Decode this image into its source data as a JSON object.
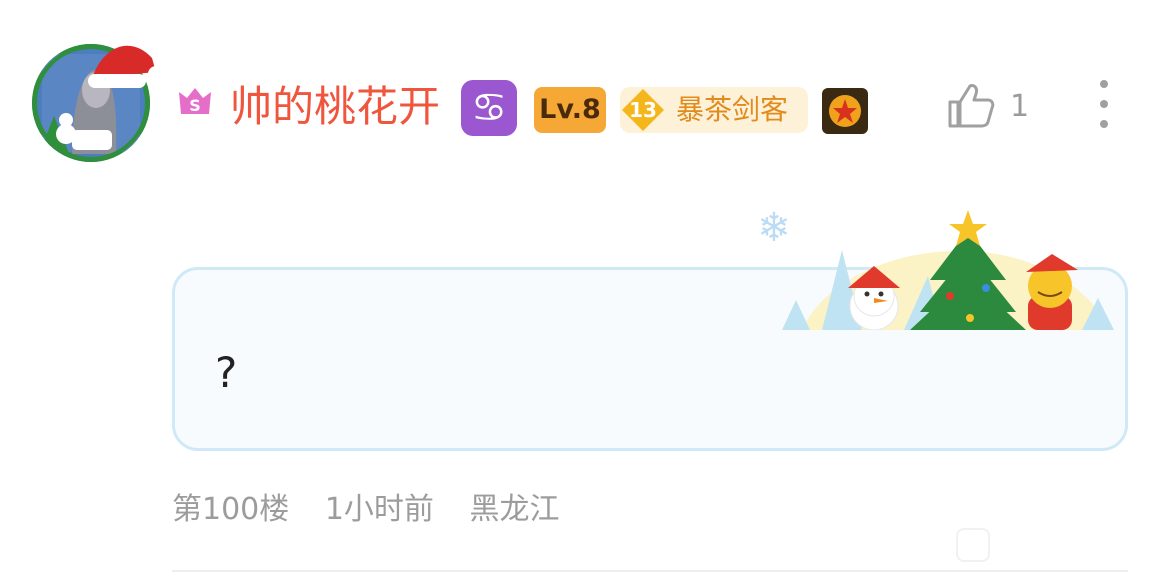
{
  "post": {
    "username": "帅的桃花开",
    "zodiac_symbol": "♋",
    "level_label": "Lv.8",
    "fan_badge": {
      "level": "13",
      "name": "暴茶剑客"
    },
    "likes": "1",
    "content": "?",
    "meta": {
      "floor": "第100楼",
      "time": "1小时前",
      "location": "黑龙江"
    }
  },
  "icons": {
    "avatar": "christmas-avatar",
    "vip": "vip-s-icon",
    "like": "thumbs-up-icon",
    "more": "more-vertical-icon",
    "decoration": "christmas-snowman-tree-decoration"
  },
  "colors": {
    "username": "#f0553e",
    "level_badge": "#f6a836",
    "zodiac_badge": "#9b57cf",
    "bubble_border": "#cfe9f6",
    "meta_text": "#9c9c9c"
  }
}
